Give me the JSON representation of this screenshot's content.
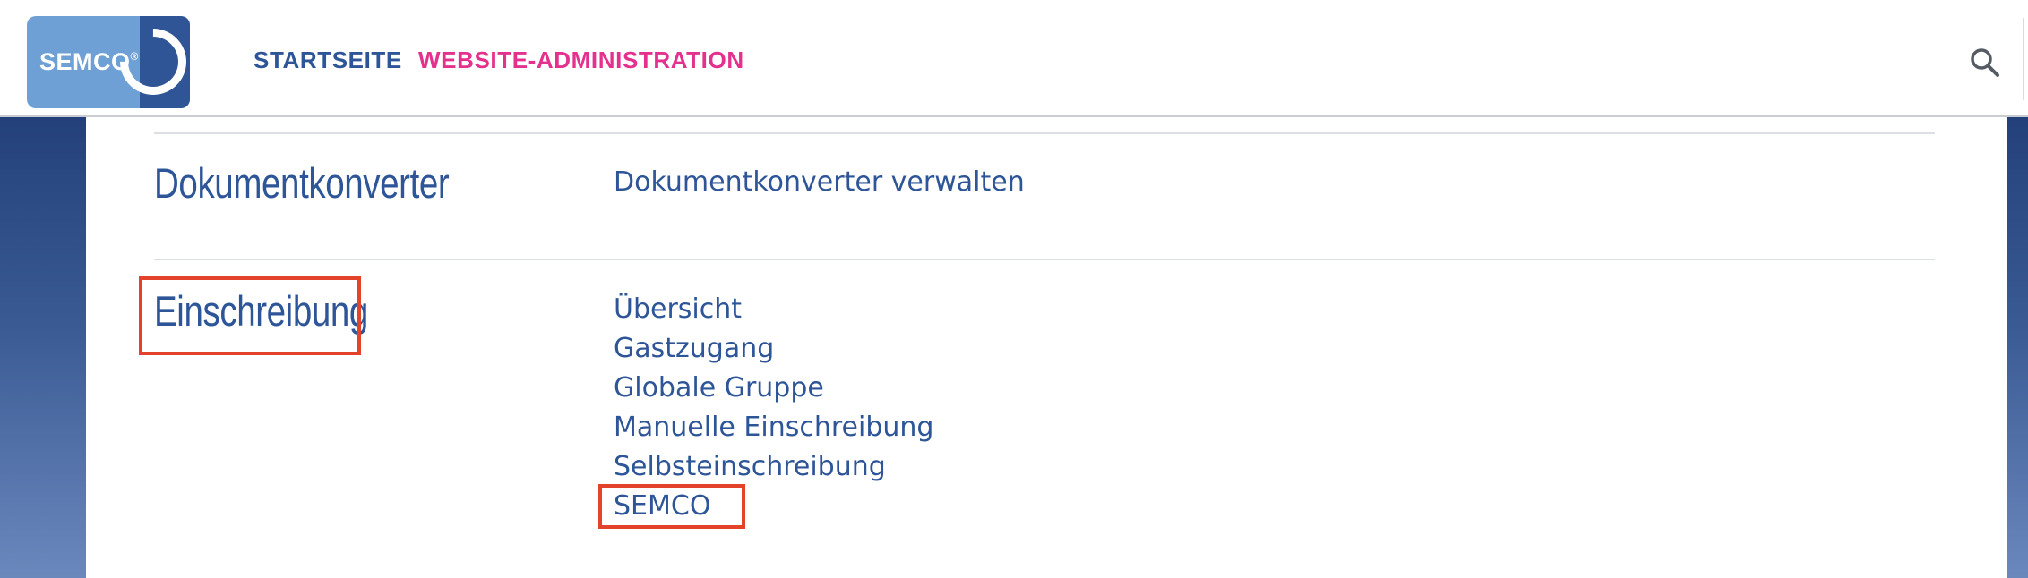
{
  "header": {
    "logo_text": "SEMCO",
    "logo_mark": "®",
    "nav": [
      {
        "label": "STARTSEITE"
      },
      {
        "label": "WEBSITE-ADMINISTRATION"
      }
    ],
    "search_icon": "search-icon",
    "colors": {
      "nav_home": "#2d5597",
      "nav_active": "#e5318e"
    }
  },
  "sections": [
    {
      "title": "Dokumentkonverter",
      "links": [
        "Dokumentkonverter verwalten"
      ]
    },
    {
      "title": "Einschreibung",
      "links": [
        "Übersicht",
        "Gastzugang",
        "Globale Gruppe",
        "Manuelle Einschreibung",
        "Selbsteinschreibung",
        "SEMCO"
      ]
    }
  ],
  "annotations": {
    "highlight_color": "#e3432b"
  }
}
